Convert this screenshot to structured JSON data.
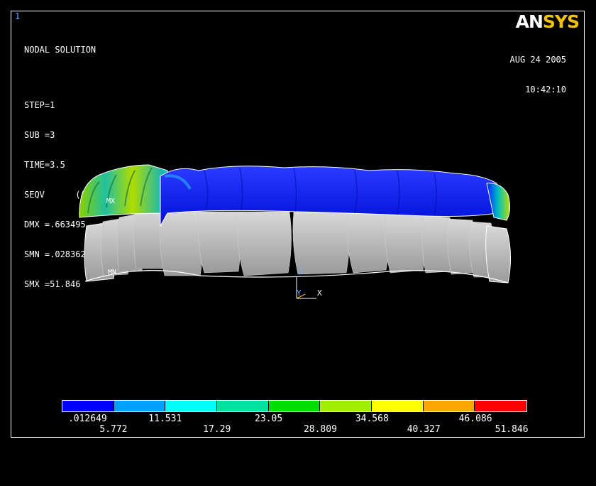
{
  "window": {
    "number": "1"
  },
  "header": {
    "lines": [
      "NODAL SOLUTION",
      "STEP=1",
      "SUB =3",
      "TIME=3.5",
      "SEQV      (AVG)",
      "DMX =.663495",
      "SMN =.028362",
      "SMX =51.846"
    ]
  },
  "timestamp": {
    "date": "AUG 24 2005",
    "time": "10:42:10"
  },
  "logo": {
    "an": "AN",
    "sys": "SYS"
  },
  "model": {
    "max_label": "MX",
    "min_label": "MN",
    "triad": {
      "z": "Z",
      "y": "Y",
      "x": "X"
    }
  },
  "legend": {
    "colors": [
      "#0000ff",
      "#00a0ff",
      "#00ffff",
      "#00e0a0",
      "#00dd00",
      "#a0ee00",
      "#ffff00",
      "#ffa500",
      "#ff0000"
    ],
    "top_labels": [
      ".012649",
      "11.531",
      "23.05",
      "34.568",
      "46.086"
    ],
    "bottom_labels": [
      "5.772",
      "17.29",
      "28.809",
      "40.327",
      "51.846"
    ]
  }
}
